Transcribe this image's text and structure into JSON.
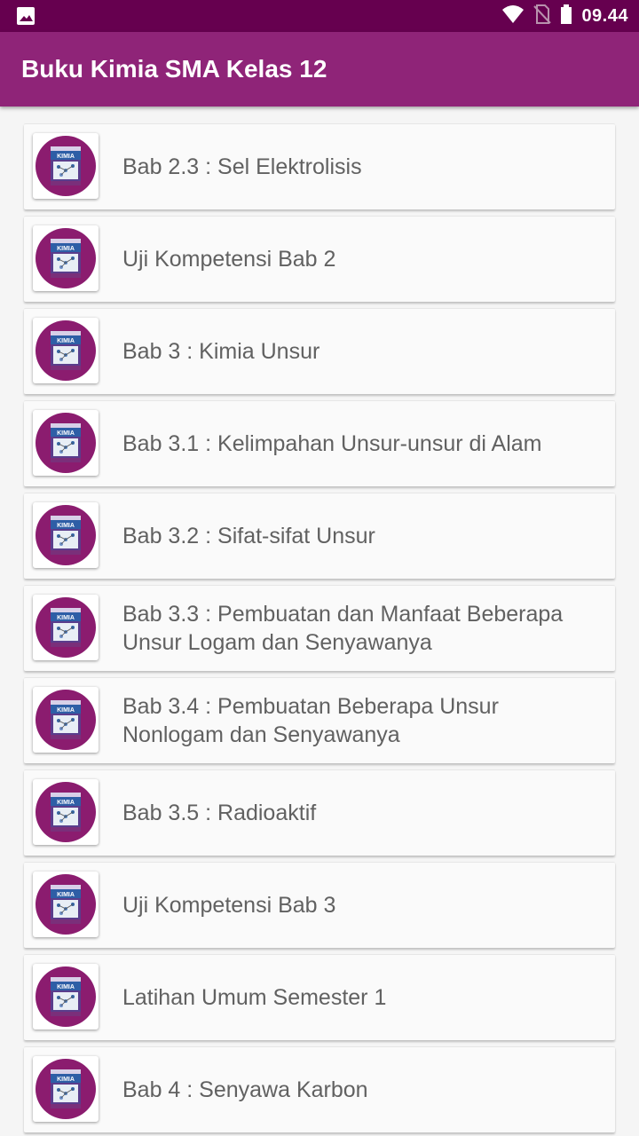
{
  "status_bar": {
    "time": "09.44",
    "icons": [
      "image-icon",
      "wifi-icon",
      "no-sim-icon",
      "battery-icon"
    ]
  },
  "app_bar": {
    "title": "Buku Kimia SMA Kelas 12"
  },
  "colors": {
    "status_bar": "#66004f",
    "app_bar": "#8f2478",
    "thumb_circle": "#8b1c6f"
  },
  "thumbnail": {
    "book_title": "KIMIA",
    "icon": "kimia-book-cover-icon"
  },
  "items": [
    {
      "label": "Bab 2.3 : Sel Elektrolisis"
    },
    {
      "label": "Uji Kompetensi Bab 2"
    },
    {
      "label": "Bab 3 : Kimia Unsur"
    },
    {
      "label": "Bab 3.1 : Kelimpahan Unsur-unsur di Alam"
    },
    {
      "label": "Bab 3.2 : Sifat-sifat Unsur"
    },
    {
      "label": "Bab 3.3 : Pembuatan dan Manfaat Beberapa Unsur Logam dan Senyawanya"
    },
    {
      "label": "Bab 3.4 : Pembuatan Beberapa Unsur Nonlogam dan Senyawanya"
    },
    {
      "label": "Bab 3.5 : Radioaktif"
    },
    {
      "label": "Uji Kompetensi Bab 3"
    },
    {
      "label": "Latihan Umum Semester 1"
    },
    {
      "label": "Bab 4 : Senyawa Karbon"
    }
  ]
}
